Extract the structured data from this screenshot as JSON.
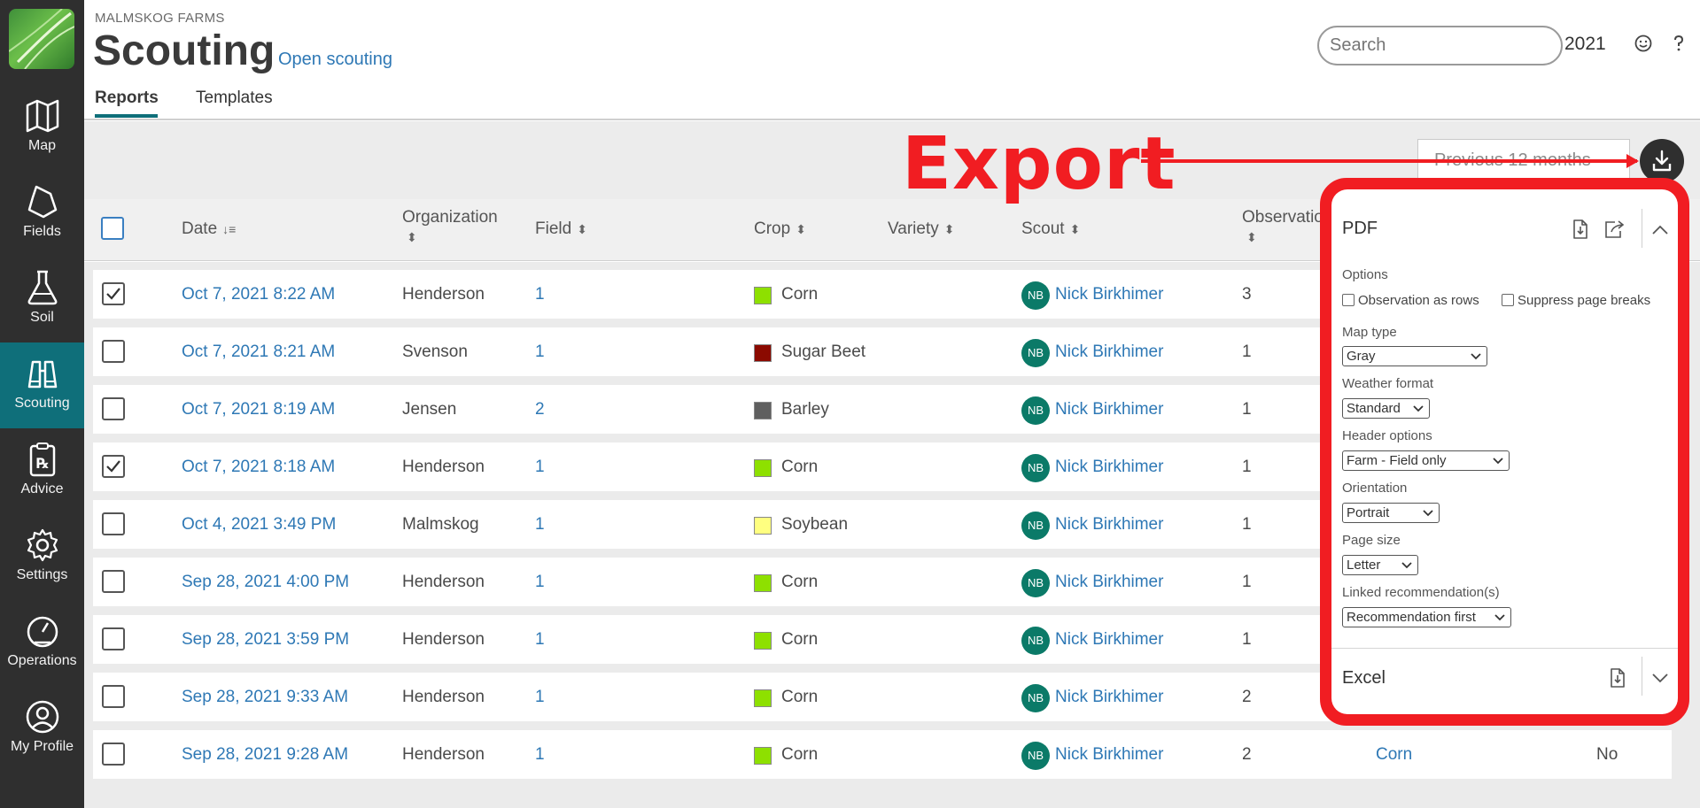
{
  "app": {
    "org_name": "MALMSKOG FARMS",
    "title": "Scouting",
    "open_link": "Open scouting",
    "year": "2021",
    "search_placeholder": "Search"
  },
  "tabs": [
    {
      "label": "Reports",
      "active": true
    },
    {
      "label": "Templates",
      "active": false
    }
  ],
  "sidebar": {
    "items": [
      {
        "label": "Map",
        "icon": "map-icon"
      },
      {
        "label": "Fields",
        "icon": "fields-icon"
      },
      {
        "label": "Soil",
        "icon": "flask-icon"
      },
      {
        "label": "Scouting",
        "icon": "binoculars-icon",
        "active": true
      },
      {
        "label": "Advice",
        "icon": "prescription-icon"
      },
      {
        "label": "Settings",
        "icon": "gear-icon"
      },
      {
        "label": "Operations",
        "icon": "gauge-icon"
      },
      {
        "label": "My Profile",
        "icon": "user-icon"
      }
    ]
  },
  "toolbar": {
    "period": "Previous 12 months",
    "annotation": "Export"
  },
  "table": {
    "columns": {
      "date": "Date",
      "organization": "Organization",
      "field": "Field",
      "crop": "Crop",
      "variety": "Variety",
      "scout": "Scout",
      "observations": "Observatio"
    },
    "rows": [
      {
        "checked": true,
        "date": "Oct 7, 2021 8:22 AM",
        "org": "Henderson",
        "field": "1",
        "crop": "Corn",
        "crop_color": "#8ee000",
        "scout_initials": "NB",
        "scout": "Nick Birkhimer",
        "obs": "3"
      },
      {
        "checked": false,
        "date": "Oct 7, 2021 8:21 AM",
        "org": "Svenson",
        "field": "1",
        "crop": "Sugar Beet",
        "crop_color": "#8b0a00",
        "scout_initials": "NB",
        "scout": "Nick Birkhimer",
        "obs": "1"
      },
      {
        "checked": false,
        "date": "Oct 7, 2021 8:19 AM",
        "org": "Jensen",
        "field": "2",
        "crop": "Barley",
        "crop_color": "#5f5f5f",
        "scout_initials": "NB",
        "scout": "Nick Birkhimer",
        "obs": "1"
      },
      {
        "checked": true,
        "date": "Oct 7, 2021 8:18 AM",
        "org": "Henderson",
        "field": "1",
        "crop": "Corn",
        "crop_color": "#8ee000",
        "scout_initials": "NB",
        "scout": "Nick Birkhimer",
        "obs": "1"
      },
      {
        "checked": false,
        "date": "Oct 4, 2021 3:49 PM",
        "org": "Malmskog",
        "field": "1",
        "crop": "Soybean",
        "crop_color": "#ffff80",
        "scout_initials": "NB",
        "scout": "Nick Birkhimer",
        "obs": "1"
      },
      {
        "checked": false,
        "date": "Sep 28, 2021 4:00 PM",
        "org": "Henderson",
        "field": "1",
        "crop": "Corn",
        "crop_color": "#8ee000",
        "scout_initials": "NB",
        "scout": "Nick Birkhimer",
        "obs": "1"
      },
      {
        "checked": false,
        "date": "Sep 28, 2021 3:59 PM",
        "org": "Henderson",
        "field": "1",
        "crop": "Corn",
        "crop_color": "#8ee000",
        "scout_initials": "NB",
        "scout": "Nick Birkhimer",
        "obs": "1"
      },
      {
        "checked": false,
        "date": "Sep 28, 2021 9:33 AM",
        "org": "Henderson",
        "field": "1",
        "crop": "Corn",
        "crop_color": "#8ee000",
        "scout_initials": "NB",
        "scout": "Nick Birkhimer",
        "obs": "2"
      },
      {
        "checked": false,
        "date": "Sep 28, 2021 9:28 AM",
        "org": "Henderson",
        "field": "1",
        "crop": "Corn",
        "crop_color": "#8ee000",
        "scout_initials": "NB",
        "scout": "Nick Birkhimer",
        "obs": "2",
        "extra_crop": "Corn",
        "extra_value": "No"
      }
    ]
  },
  "export_panel": {
    "pdf_title": "PDF",
    "options_label": "Options",
    "obs_as_rows": "Observation as rows",
    "suppress_breaks": "Suppress page breaks",
    "map_type_label": "Map type",
    "map_type_value": "Gray",
    "weather_label": "Weather format",
    "weather_value": "Standard",
    "header_label": "Header options",
    "header_value": "Farm - Field only",
    "orientation_label": "Orientation",
    "orientation_value": "Portrait",
    "page_size_label": "Page size",
    "page_size_value": "Letter",
    "linked_label": "Linked recommendation(s)",
    "linked_value": "Recommendation first",
    "excel_title": "Excel"
  },
  "colors": {
    "sidebar": "#2f2f2f",
    "accent": "#0f6f7a",
    "link": "#2e78b5",
    "annotation": "#f11d22",
    "avatar": "#0b7a68"
  }
}
